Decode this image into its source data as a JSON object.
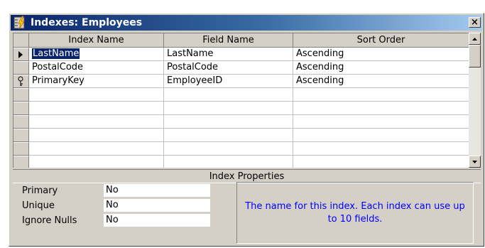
{
  "window": {
    "title": "Indexes: Employees",
    "close_label": "×"
  },
  "grid": {
    "columns": [
      "Index Name",
      "Field Name",
      "Sort Order"
    ],
    "rows": [
      {
        "index_name": "LastName",
        "field_name": "LastName",
        "sort_order": "Ascending",
        "indicator": "current-record-icon"
      },
      {
        "index_name": "PostalCode",
        "field_name": "PostalCode",
        "sort_order": "Ascending",
        "indicator": ""
      },
      {
        "index_name": "PrimaryKey",
        "field_name": "EmployeeID",
        "sort_order": "Ascending",
        "indicator": "primary-key-icon"
      },
      {
        "index_name": "",
        "field_name": "",
        "sort_order": "",
        "indicator": ""
      },
      {
        "index_name": "",
        "field_name": "",
        "sort_order": "",
        "indicator": ""
      },
      {
        "index_name": "",
        "field_name": "",
        "sort_order": "",
        "indicator": ""
      },
      {
        "index_name": "",
        "field_name": "",
        "sort_order": "",
        "indicator": ""
      },
      {
        "index_name": "",
        "field_name": "",
        "sort_order": "",
        "indicator": ""
      }
    ]
  },
  "properties": {
    "header": "Index Properties",
    "items": [
      {
        "label": "Primary",
        "value": "No"
      },
      {
        "label": "Unique",
        "value": "No"
      },
      {
        "label": "Ignore Nulls",
        "value": "No"
      }
    ],
    "help_text": "The name for this index.  Each index can use up to 10 fields."
  },
  "colors": {
    "title_start": "#0a246a",
    "title_end": "#a6caf0",
    "face": "#d4d0c8",
    "help_text": "#0000ff"
  }
}
